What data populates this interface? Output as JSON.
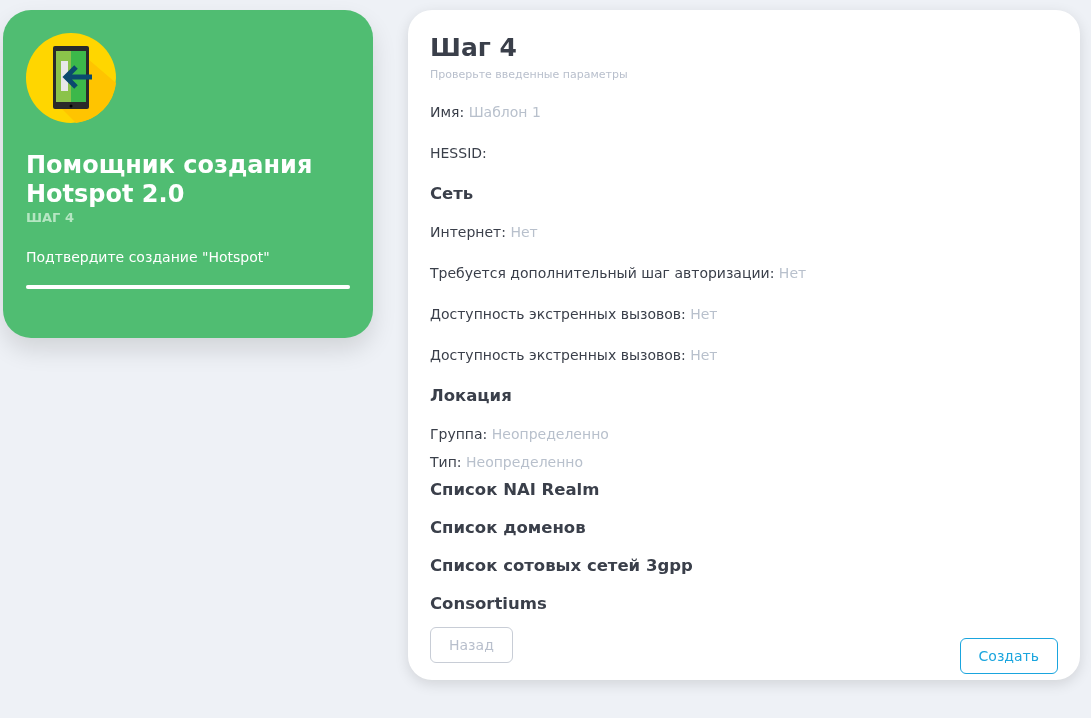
{
  "wizard": {
    "title": "Помощник создания Hotspot 2.0",
    "step": "ШАГ 4",
    "description": "Подтвердите создание \"Hotspot\"",
    "progress": {
      "level": 1
    }
  },
  "panel": {
    "title": "Шаг 4",
    "subtitle": "Проверьте введенные параметры",
    "items": [
      {
        "kind": "field",
        "label": "Имя:",
        "value": "Шаблон 1"
      },
      {
        "kind": "field",
        "label": "HESSID:"
      },
      {
        "kind": "heading",
        "label": "Сеть"
      },
      {
        "kind": "field",
        "label": "Интернет:",
        "value": "Нет"
      },
      {
        "kind": "field",
        "label": "Требуется дополнительный шаг авторизации:",
        "value": "Нет"
      },
      {
        "kind": "field",
        "label": "Доступность экстренных вызовов:",
        "value": "Нет"
      },
      {
        "kind": "field",
        "label": "Доступность экстренных вызовов:",
        "value": "Нет"
      },
      {
        "kind": "heading",
        "label": "Локация"
      },
      {
        "kind": "compact",
        "label": "Группа:",
        "value": "Неопределенно"
      },
      {
        "kind": "compact",
        "label": "Тип:",
        "value": "Неопределенно"
      },
      {
        "kind": "heading",
        "label": "Список NAI Realm"
      },
      {
        "kind": "heading",
        "label": "Список доменов"
      },
      {
        "kind": "heading",
        "label": "Список сотовых сетей 3gpp"
      },
      {
        "kind": "heading",
        "label": "Consortiums"
      }
    ],
    "buttons": [
      {
        "label": "Назад",
        "disabled": true
      },
      {
        "label": "Создать",
        "disabled": false
      }
    ]
  }
}
